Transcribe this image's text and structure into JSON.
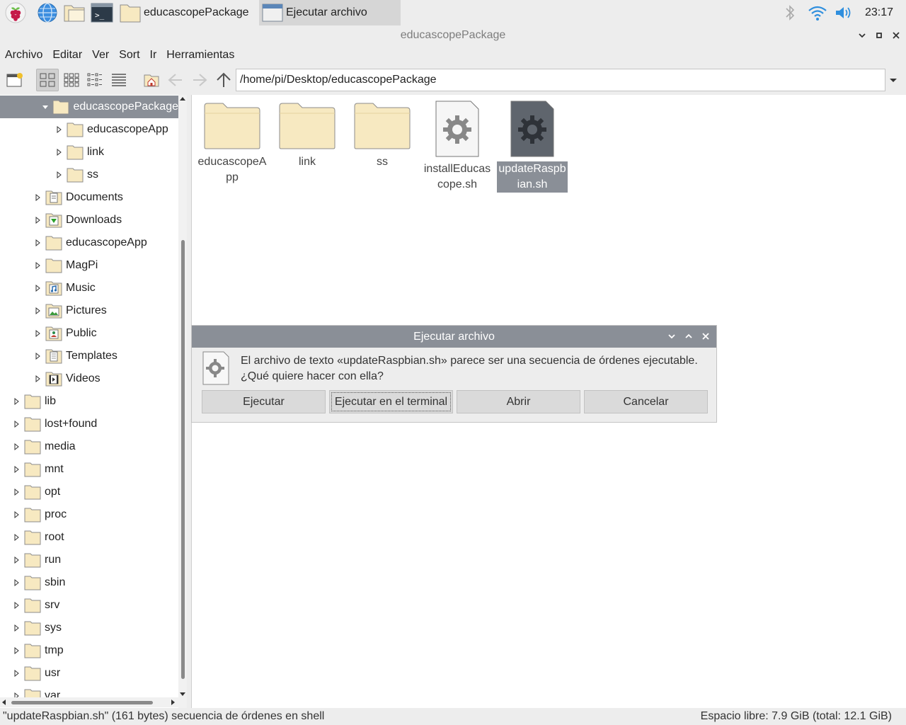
{
  "taskbar": {
    "tasks": [
      {
        "label": "educascopePackage"
      },
      {
        "label": "Ejecutar archivo"
      }
    ],
    "clock": "23:17"
  },
  "window": {
    "title": "educascopePackage"
  },
  "menubar": {
    "items": [
      "Archivo",
      "Editar",
      "Ver",
      "Sort",
      "Ir",
      "Herramientas"
    ]
  },
  "toolbar": {
    "path": "/home/pi/Desktop/educascopePackage"
  },
  "tree": {
    "items": [
      {
        "label": "educascopePackage",
        "icon": "folder-icon",
        "expanded": true,
        "selected": true
      },
      {
        "label": "educascopeApp",
        "icon": "folder-icon"
      },
      {
        "label": "link",
        "icon": "folder-icon"
      },
      {
        "label": "ss",
        "icon": "folder-icon"
      },
      {
        "label": "Documents",
        "icon": "documents-folder-icon"
      },
      {
        "label": "Downloads",
        "icon": "downloads-folder-icon"
      },
      {
        "label": "educascopeApp",
        "icon": "folder-icon"
      },
      {
        "label": "MagPi",
        "icon": "folder-icon"
      },
      {
        "label": "Music",
        "icon": "music-folder-icon"
      },
      {
        "label": "Pictures",
        "icon": "pictures-folder-icon"
      },
      {
        "label": "Public",
        "icon": "public-folder-icon"
      },
      {
        "label": "Templates",
        "icon": "templates-folder-icon"
      },
      {
        "label": "Videos",
        "icon": "videos-folder-icon"
      },
      {
        "label": "lib",
        "icon": "folder-icon"
      },
      {
        "label": "lost+found",
        "icon": "folder-icon"
      },
      {
        "label": "media",
        "icon": "folder-icon"
      },
      {
        "label": "mnt",
        "icon": "folder-icon"
      },
      {
        "label": "opt",
        "icon": "folder-icon"
      },
      {
        "label": "proc",
        "icon": "folder-icon"
      },
      {
        "label": "root",
        "icon": "folder-icon"
      },
      {
        "label": "run",
        "icon": "folder-icon"
      },
      {
        "label": "sbin",
        "icon": "folder-icon"
      },
      {
        "label": "srv",
        "icon": "folder-icon"
      },
      {
        "label": "sys",
        "icon": "folder-icon"
      },
      {
        "label": "tmp",
        "icon": "folder-icon"
      },
      {
        "label": "usr",
        "icon": "folder-icon"
      },
      {
        "label": "var",
        "icon": "folder-icon"
      }
    ]
  },
  "files": {
    "items": [
      {
        "line1": "educascopeA",
        "line2": "pp",
        "icon": "folder-icon"
      },
      {
        "line1": "link",
        "line2": "",
        "icon": "folder-icon"
      },
      {
        "line1": "ss",
        "line2": "",
        "icon": "folder-icon"
      },
      {
        "line1": "installEducas",
        "line2": "cope.sh",
        "icon": "script-file-icon"
      },
      {
        "line1": "updateRaspb",
        "line2": "ian.sh",
        "icon": "script-file-icon",
        "selected": true
      }
    ]
  },
  "dialog": {
    "title": "Ejecutar archivo",
    "line1": "El archivo de texto «updateRaspbian.sh» parece ser una secuencia de órdenes ejecutable.",
    "line2": "¿Qué quiere hacer con ella?",
    "buttons": {
      "run": "Ejecutar",
      "run_terminal": "Ejecutar en el terminal",
      "open": "Abrir",
      "cancel": "Cancelar"
    }
  },
  "status": {
    "left": "\"updateRaspbian.sh\" (161 bytes) secuencia de órdenes en shell",
    "right": "Espacio libre: 7.9 GiB (total: 12.1 GiB)"
  },
  "colors": {
    "selection": "#8a8f97",
    "folder_fill": "#f7e9c1",
    "folder_stroke": "#8c8c8c",
    "accent_blue": "#2f8fde",
    "raspberry": "#c51a4a"
  }
}
